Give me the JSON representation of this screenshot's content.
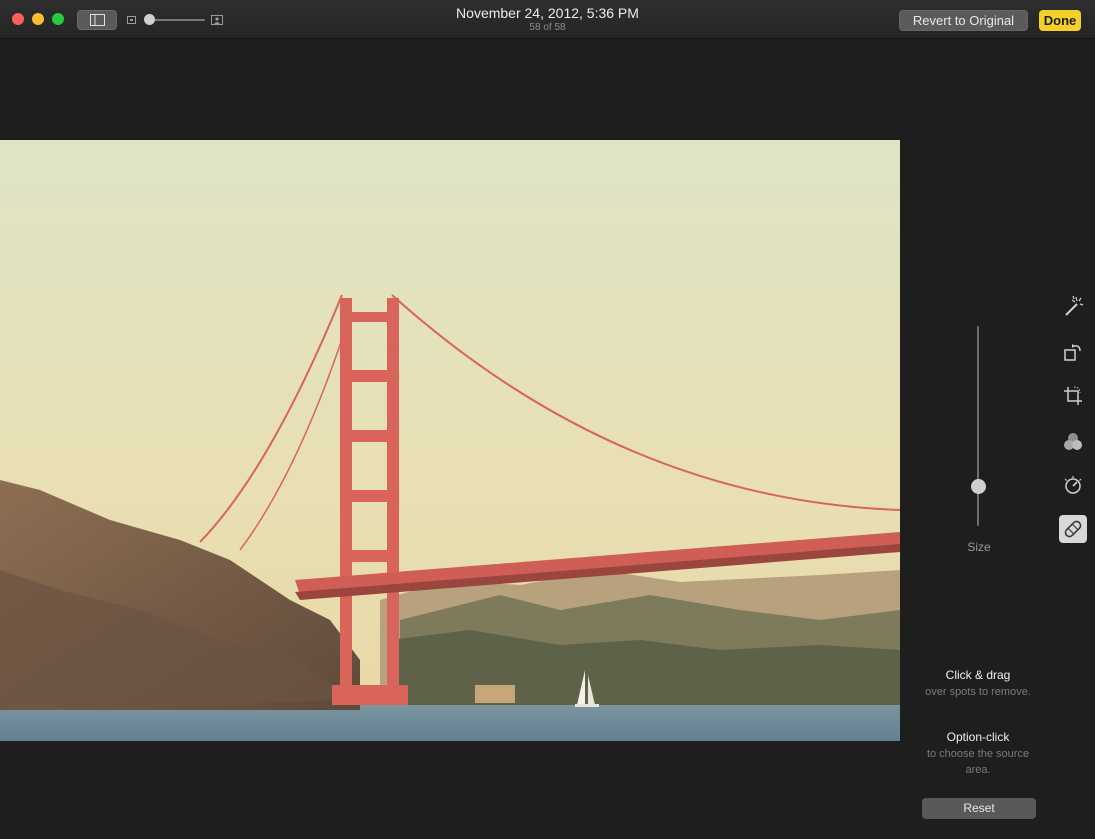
{
  "window": {
    "title": "November 24, 2012, 5:36 PM",
    "subtitle": "58 of 58"
  },
  "toolbar": {
    "revert_label": "Revert to Original",
    "done_label": "Done",
    "zoom_level": 0.08
  },
  "editor": {
    "size_label": "Size",
    "size_value": 0.2,
    "tools": [
      "magic-wand-icon",
      "rotate-icon",
      "crop-icon",
      "filters-icon",
      "adjust-icon",
      "retouch-icon"
    ],
    "active_tool": "retouch",
    "hint1_title": "Click & drag",
    "hint1_body": "over spots to remove.",
    "hint2_title": "Option-click",
    "hint2_body": "to choose the source area.",
    "reset_label": "Reset"
  },
  "colors": {
    "accent_done": "#f3cf2a",
    "close": "#fc5f57",
    "minimize": "#fdbb2e",
    "zoom": "#28c840"
  }
}
